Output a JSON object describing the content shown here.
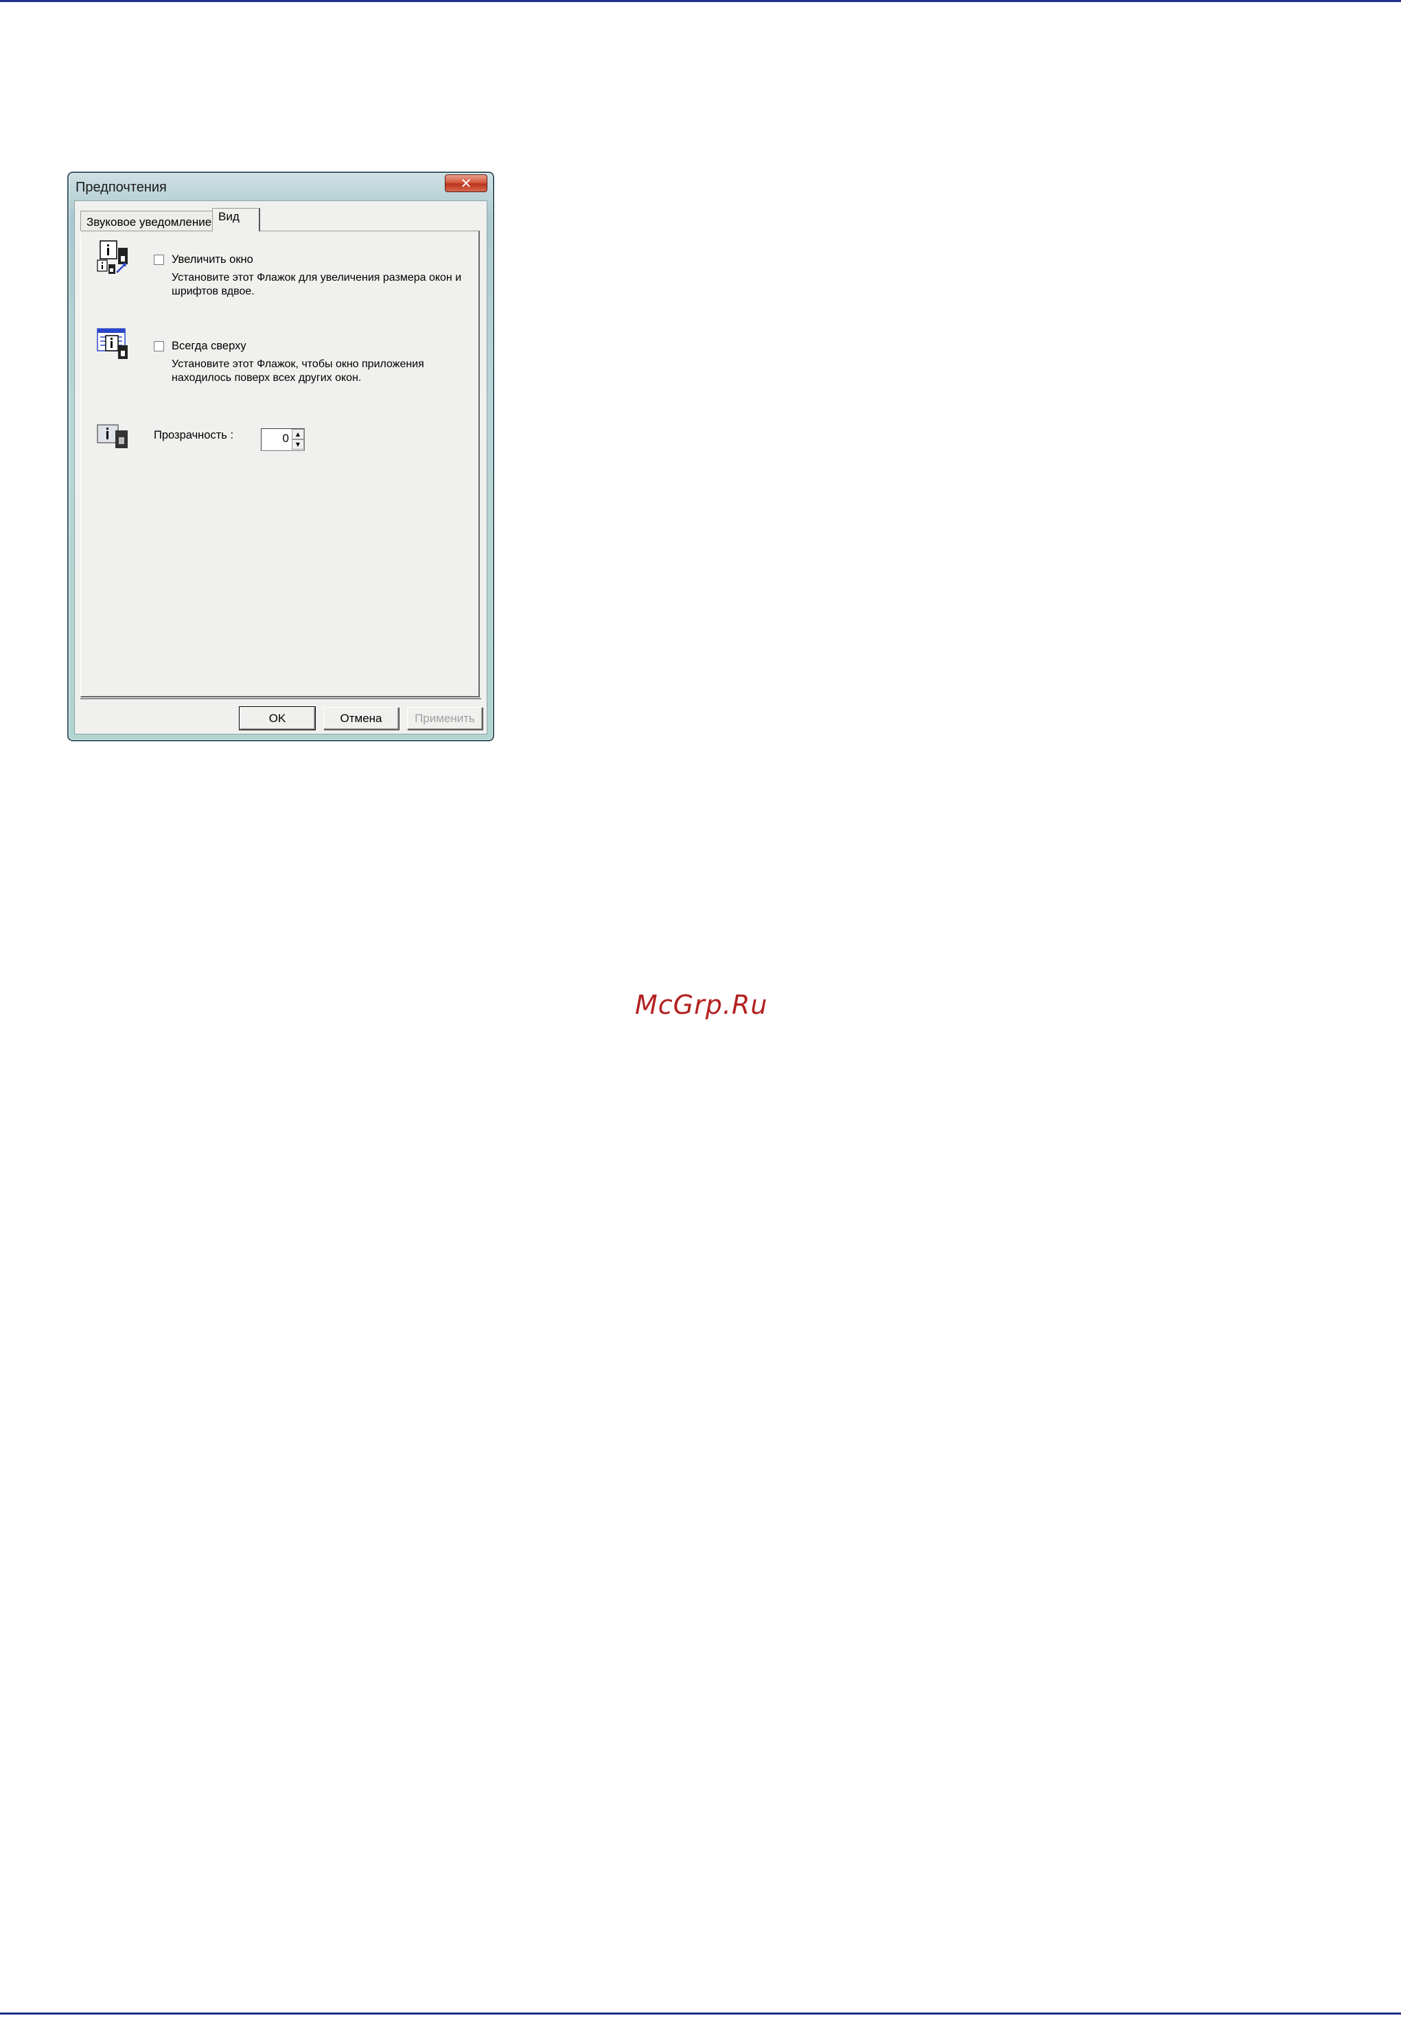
{
  "window": {
    "title": "Предпочтения",
    "close_glyph": "✕"
  },
  "tabs": [
    {
      "label": "Звуковое уведомление",
      "active": false
    },
    {
      "label": "Вид",
      "active": true
    }
  ],
  "options": {
    "enlarge": {
      "label": "Увеличить окно",
      "description": "Установите этот Флажок для увеличения размера окон и шрифтов вдвое.",
      "checked": false,
      "icon": "enlarge-window-icon"
    },
    "on_top": {
      "label": "Всегда сверху",
      "description": "Установите этот Флажок, чтобы окно приложения находилось поверх всех других окон.",
      "checked": false,
      "icon": "always-on-top-icon"
    },
    "transparency": {
      "label": "Прозрачность :",
      "value": "0",
      "icon": "transparency-icon"
    }
  },
  "buttons": {
    "ok": "OK",
    "cancel": "Отмена",
    "apply": "Применить"
  },
  "watermark": "McGrp.Ru",
  "colors": {
    "rule": "#1f2f8c",
    "watermark": "#b32121",
    "dialog_face": "#f0f0ee"
  }
}
